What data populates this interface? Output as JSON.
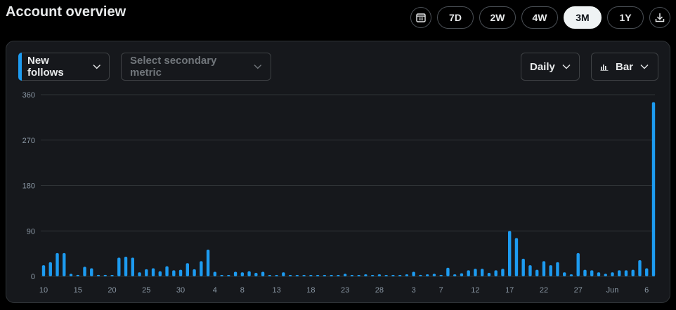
{
  "page": {
    "title": "Account overview"
  },
  "range_selector": {
    "calendar_icon": "calendar-icon",
    "options": [
      "7D",
      "2W",
      "4W",
      "3M",
      "1Y"
    ],
    "active": "3M",
    "download_icon": "download-icon"
  },
  "controls": {
    "primary_metric": "New follows",
    "secondary_metric_placeholder": "Select secondary metric",
    "interval": "Daily",
    "chart_type": "Bar",
    "chart_type_icon": "bar-chart-icon"
  },
  "colors": {
    "accent": "#1d9bf0",
    "background": "#000000",
    "card": "#16181c"
  },
  "chart_data": {
    "type": "bar",
    "series": [
      {
        "values": [
          22,
          28,
          46,
          46,
          5,
          3,
          19,
          16,
          3,
          3,
          2,
          37,
          39,
          37,
          8,
          14,
          16,
          10,
          20,
          12,
          13,
          26,
          14,
          30,
          53,
          9,
          2,
          2,
          9,
          8,
          10,
          7,
          9,
          2,
          2,
          8,
          2,
          2,
          0,
          2,
          2,
          2,
          2,
          2,
          5,
          2,
          2,
          4,
          2,
          4,
          0,
          2,
          2,
          4,
          9,
          3,
          4,
          5,
          3,
          17,
          4,
          6,
          12,
          15,
          15,
          7,
          12,
          15,
          90,
          76,
          35,
          22,
          13,
          30,
          22,
          28,
          8,
          4,
          46,
          13,
          12,
          8,
          5,
          8,
          12,
          12,
          13,
          32,
          16,
          345
        ]
      }
    ],
    "x_tick_labels": [
      "10",
      "15",
      "20",
      "25",
      "30",
      "4",
      "8",
      "13",
      "18",
      "23",
      "28",
      "3",
      "7",
      "12",
      "17",
      "22",
      "27",
      "Jun",
      "6"
    ],
    "y_ticks": [
      0,
      90,
      180,
      270,
      360
    ],
    "ylim": [
      0,
      360
    ],
    "grid": true
  }
}
